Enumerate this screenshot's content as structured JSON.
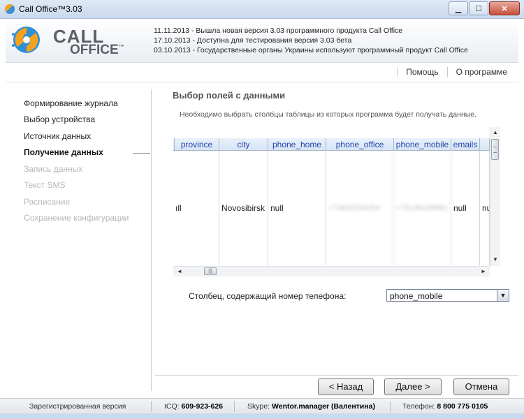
{
  "window": {
    "title": "Call Office™3.03"
  },
  "logo": {
    "line1": "CALL",
    "line2": "OFFICE",
    "tm": "™"
  },
  "news": [
    "11.11.2013 - Вышла новая версия 3.03 программного продукта Call Office",
    "17.10.2013 - Доступна для тестирования версия 3.03 бета",
    "03.10.2013 - Государственные органы Украины используют программный продукт Call Office"
  ],
  "topnav": {
    "help": "Помощь",
    "about": "О программе"
  },
  "sidebar": {
    "items": [
      {
        "label": "Формирование журнала",
        "state": "normal"
      },
      {
        "label": "Выбор устройства",
        "state": "normal"
      },
      {
        "label": "Источник данных",
        "state": "normal"
      },
      {
        "label": "Получение данных",
        "state": "active"
      },
      {
        "label": "Запись данных",
        "state": "disabled"
      },
      {
        "label": "Текст SMS",
        "state": "disabled"
      },
      {
        "label": "Расписание",
        "state": "disabled"
      },
      {
        "label": "Сохранение конфигурации",
        "state": "disabled"
      }
    ]
  },
  "main": {
    "title": "Выбор полей с данными",
    "description": "Необходимо выбрать столбцы таблицы из которых программа будет получать данные."
  },
  "grid": {
    "columns": [
      "province",
      "city",
      "phone_home",
      "phone_office",
      "phone_mobile",
      "emails"
    ],
    "row": [
      "ıll",
      "Novosibirsk",
      "null",
      "+73832254254",
      "+79139158881",
      "null",
      "nu"
    ]
  },
  "phone_column": {
    "label": "Столбец, содержащий номер телефона:",
    "selected": "phone_mobile"
  },
  "buttons": {
    "back": "< Назад",
    "next": "Далее >",
    "cancel": "Отмена"
  },
  "status": {
    "version": "Зарегистрированная версия",
    "icq_label": "ICQ:",
    "icq": "609-923-626",
    "skype_label": "Skype:",
    "skype": "Wentor.manager",
    "skype_name": "(Валентина)",
    "phone_label": "Телефон:",
    "phone": "8 800 775 0105"
  }
}
